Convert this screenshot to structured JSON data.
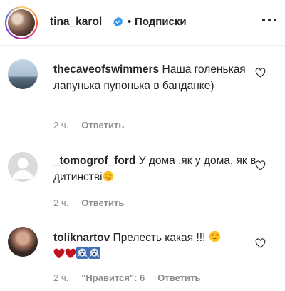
{
  "header": {
    "username": "tina_karol",
    "separator": "•",
    "follow_label": "Подписки"
  },
  "comments": [
    {
      "username": "thecaveofswimmers",
      "text": "Наша голенькая лапунька пупонька в банданке)",
      "time": "2 ч.",
      "reply_label": "Ответить"
    },
    {
      "username": "_tomogrof_ford",
      "text": "У дома ,як у дома, як в дитинстві",
      "time": "2 ч.",
      "reply_label": "Ответить"
    },
    {
      "username": "toliknartov",
      "text": "Прелесть какая !!!",
      "time": "2 ч.",
      "likes_label": "\"Нравится\": 6",
      "reply_label": "Ответить"
    }
  ],
  "colors": {
    "text": "#262626",
    "meta": "#8e8e8e",
    "verified": "#3897f0",
    "heart": "#ed4956",
    "divider": "#efefef"
  },
  "icons": [
    "verified-badge-icon",
    "more-options-icon",
    "heart-outline-icon",
    "smiling-face-icon",
    "red-heart-icon",
    "scream-face-icon"
  ]
}
